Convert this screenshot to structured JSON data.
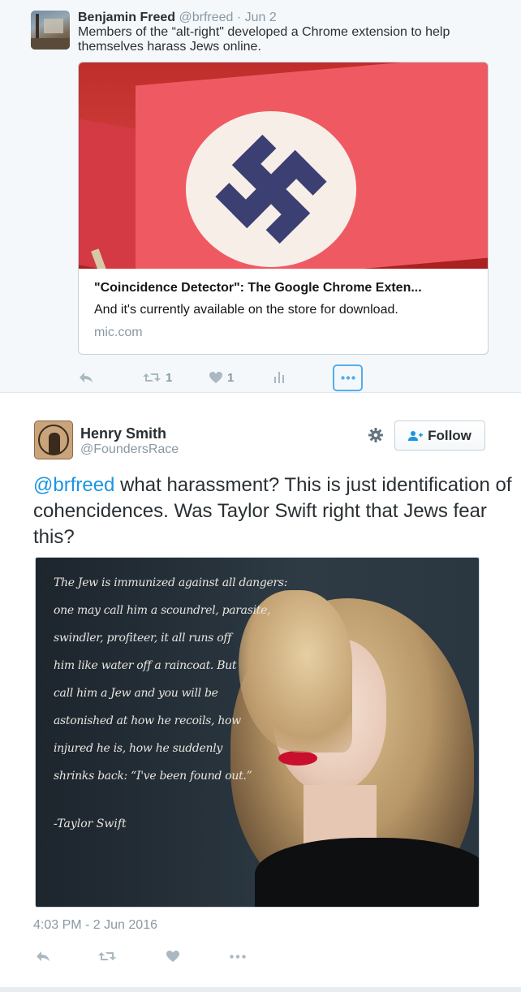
{
  "context_tweet": {
    "name": "Benjamin Freed",
    "handle": "@brfreed",
    "date": "· Jun 2",
    "text": "Members of the “alt-right\" developed a Chrome extension to help themselves harass Jews online.",
    "card": {
      "title": "\"Coincidence Detector\": The Google Chrome Exten...",
      "description": "And it's currently available on the store for download.",
      "domain": "mic.com"
    },
    "actions": {
      "reply_icon": "reply-icon",
      "retweet_icon": "retweet-icon",
      "retweet_count": "1",
      "like_icon": "heart-icon",
      "like_count": "1",
      "analytics_icon": "bar-chart-icon",
      "more_icon": "more-dots-icon"
    }
  },
  "main_tweet": {
    "name": "Henry Smith",
    "handle": "@FoundersRace",
    "follow_label": "Follow",
    "mention": "@brfreed",
    "text": " what harassment? This is just identification of cohencidences. Was Taylor Swift right that Jews fear this?",
    "image_quote": {
      "lines": [
        "The Jew is immunized against all dangers:",
        "one may call him a scoundrel, parasite,",
        "swindler, profiteer, it all runs off",
        "him like water off a raincoat. But",
        "call him a Jew and you will be",
        "astonished at how he recoils, how",
        "injured he is, how he suddenly",
        "shrinks back: “I've been found out.”"
      ],
      "signature": "-Taylor Swift"
    },
    "timestamp": "4:03 PM - 2 Jun 2016",
    "actions": {
      "reply_icon": "reply-icon",
      "retweet_icon": "retweet-icon",
      "like_icon": "heart-icon",
      "more_icon": "more-dots-icon"
    }
  },
  "colors": {
    "link": "#1b95e0",
    "muted": "#8899a6",
    "icon": "#aab8c2",
    "text": "#292f33",
    "focus": "#55acee"
  }
}
